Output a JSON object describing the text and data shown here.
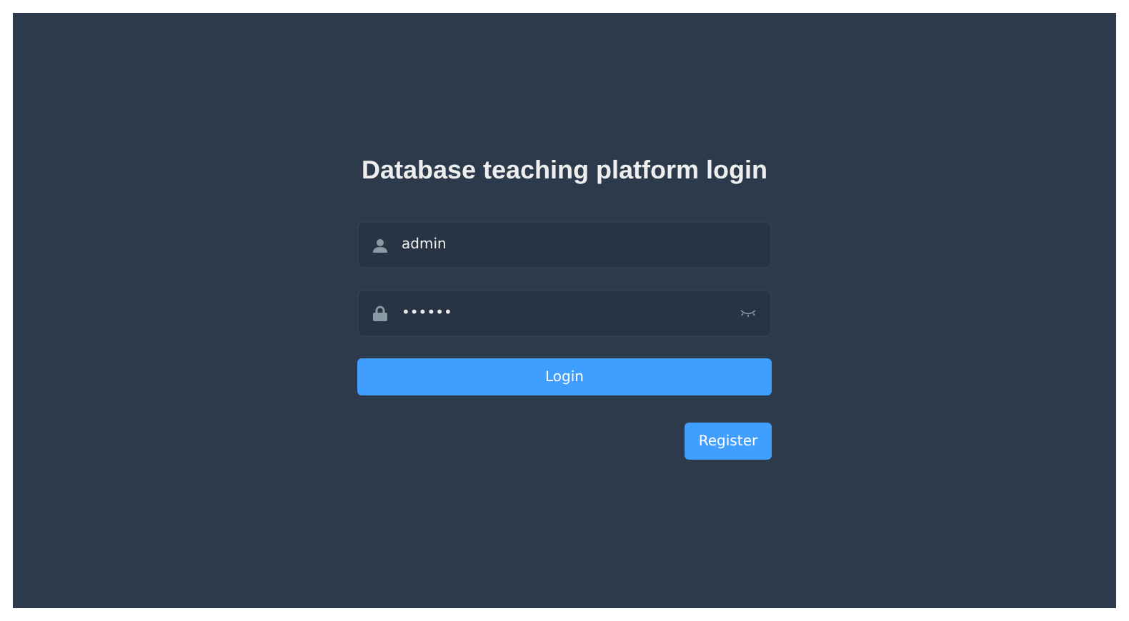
{
  "title": "Database teaching platform login",
  "username": {
    "value": "admin"
  },
  "password": {
    "value": "••••••"
  },
  "buttons": [
    {
      "kind": "primary",
      "label": "Login"
    },
    {
      "kind": "secondary",
      "label": "Register"
    }
  ]
}
